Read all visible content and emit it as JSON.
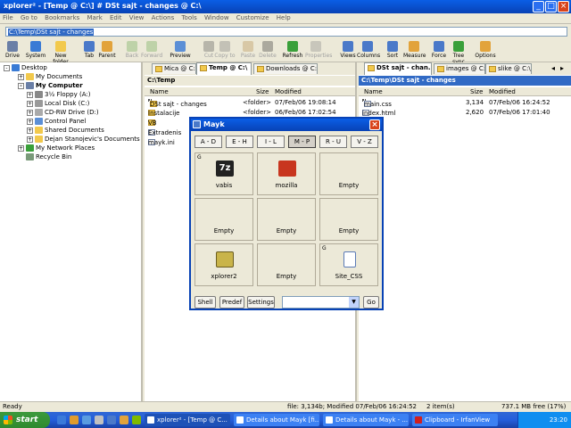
{
  "window": {
    "title": "xplorer² - [Temp @ C:\\] # DSt sajt - changes @ C:\\"
  },
  "menu": [
    "File",
    "Go to",
    "Bookmarks",
    "Mark",
    "Edit",
    "View",
    "Actions",
    "Tools",
    "Window",
    "Customize",
    "Help"
  ],
  "address": {
    "value": "C:\\Temp\\DSt sajt - changes"
  },
  "toolbar": {
    "buttons": [
      {
        "label": "Drive",
        "icon": "drive-icon",
        "color": "#6a7fa6"
      },
      {
        "label": "System",
        "icon": "system-icon",
        "color": "#3a7bd5"
      },
      {
        "label": "New folder",
        "icon": "new-folder-icon",
        "color": "#f2c94c"
      },
      {
        "label": "Tab",
        "icon": "tab-icon",
        "color": "#4a79c9"
      },
      {
        "label": "Parent",
        "icon": "parent-icon",
        "color": "#e2a33b"
      },
      {
        "label": "Back",
        "icon": "back-icon",
        "color": "#6aa84f"
      },
      {
        "label": "Forward",
        "icon": "forward-icon",
        "color": "#6aa84f"
      },
      {
        "label": "Preview",
        "icon": "preview-icon",
        "color": "#5b8fd6"
      },
      {
        "label": "Cut",
        "icon": "cut-icon",
        "color": "#555555"
      },
      {
        "label": "Copy to",
        "icon": "copy-to-icon",
        "color": "#777777"
      },
      {
        "label": "Paste",
        "icon": "paste-icon",
        "color": "#b58b4a"
      },
      {
        "label": "Delete",
        "icon": "delete-icon",
        "color": "#333333"
      },
      {
        "label": "Refresh",
        "icon": "refresh-icon",
        "color": "#3aa03a"
      },
      {
        "label": "Properties",
        "icon": "properties-icon",
        "color": "#888888"
      },
      {
        "label": "Views",
        "icon": "views-icon",
        "color": "#4a79c9"
      },
      {
        "label": "Columns",
        "icon": "columns-icon",
        "color": "#4a79c9"
      },
      {
        "label": "Sort",
        "icon": "sort-icon",
        "color": "#4a79c9"
      },
      {
        "label": "Measure",
        "icon": "measure-icon",
        "color": "#e2a33b"
      },
      {
        "label": "Force",
        "icon": "force-icon",
        "color": "#4a79c9"
      },
      {
        "label": "Tree sync",
        "icon": "tree-sync-icon",
        "color": "#3aa03a"
      },
      {
        "label": "Options",
        "icon": "options-icon",
        "color": "#e2a33b"
      }
    ]
  },
  "tree": {
    "items": [
      {
        "label": "Desktop",
        "icon": "desktop-icon"
      },
      {
        "label": "My Documents",
        "icon": "folder-icon"
      },
      {
        "label": "My Computer",
        "icon": "computer-icon"
      },
      {
        "label": "3½ Floppy (A:)",
        "icon": "floppy-icon"
      },
      {
        "label": "Local Disk (C:)",
        "icon": "disk-icon"
      },
      {
        "label": "CD-RW Drive (D:)",
        "icon": "cd-icon"
      },
      {
        "label": "Control Panel",
        "icon": "control-panel-icon"
      },
      {
        "label": "Shared Documents",
        "icon": "folder-icon"
      },
      {
        "label": "Dejan Stanojevic's Documents",
        "icon": "folder-icon"
      },
      {
        "label": "My Network Places",
        "icon": "network-icon"
      },
      {
        "label": "Recycle Bin",
        "icon": "recycle-bin-icon"
      }
    ]
  },
  "left_pane": {
    "tabs": [
      "Mica @ C:\\",
      "Temp @ C:\\",
      "Downloads @ C:\\"
    ],
    "path": "C:\\Temp",
    "columns": {
      "name": "Name",
      "size": "Size",
      "modified": "Modified"
    },
    "rows": [
      {
        "name": "DSt sajt - changes",
        "size": "<folder>",
        "modified": "07/Feb/06 19:08:14"
      },
      {
        "name": "Instalacije",
        "size": "<folder>",
        "modified": "06/Feb/06 17:02:54"
      },
      {
        "name": "VB",
        "size": "",
        "modified": ""
      },
      {
        "name": "Extradenis",
        "size": "",
        "modified": ""
      },
      {
        "name": "mayk.ini",
        "size": "",
        "modified": ""
      }
    ]
  },
  "right_pane": {
    "tabs": [
      "DSt sajt - chan...",
      "images @ C:\\",
      "slike @ C:\\"
    ],
    "path": "C:\\Temp\\DSt sajt - changes",
    "columns": {
      "name": "Name",
      "size": "Size",
      "modified": "Modified"
    },
    "rows": [
      {
        "name": "main.css",
        "size": "3,134",
        "modified": "07/Feb/06 16:24:52"
      },
      {
        "name": "index.html",
        "size": "2,620",
        "modified": "07/Feb/06 17:01:40"
      }
    ]
  },
  "dialog": {
    "title": "Mayk",
    "ranges": [
      "A - D",
      "E - H",
      "I - L",
      "M - P",
      "R - U",
      "V - Z"
    ],
    "slots": [
      {
        "label": "vabis",
        "g": "G",
        "icon": "7zip-icon"
      },
      {
        "label": "mozilla",
        "g": "",
        "icon": "mozilla-icon"
      },
      {
        "label": "Empty",
        "g": "",
        "icon": ""
      },
      {
        "label": "Empty",
        "g": "",
        "icon": ""
      },
      {
        "label": "Empty",
        "g": "",
        "icon": ""
      },
      {
        "label": "Empty",
        "g": "",
        "icon": ""
      },
      {
        "label": "xplorer2",
        "g": "",
        "icon": "xplorer2-icon"
      },
      {
        "label": "Empty",
        "g": "",
        "icon": ""
      },
      {
        "label": "Site_CSS",
        "g": "G",
        "icon": "site-css-icon"
      }
    ],
    "buttons": {
      "shell": "Shell",
      "predef": "Predef",
      "settings": "Settings",
      "go": "Go"
    }
  },
  "status": {
    "ready": "Ready",
    "selection": "file: 3,134b; Modified 07/Feb/06 16:24:52",
    "items": "2 item(s)",
    "free": "737.1 MB free (17%)"
  },
  "taskbar": {
    "start": "start",
    "tasks": [
      "xplorer² - [Temp @ C...",
      "Details about Mayk [fi...",
      "Details about Mayk - ...",
      "Clipboard - IrfanView"
    ],
    "clock": "23:20"
  }
}
